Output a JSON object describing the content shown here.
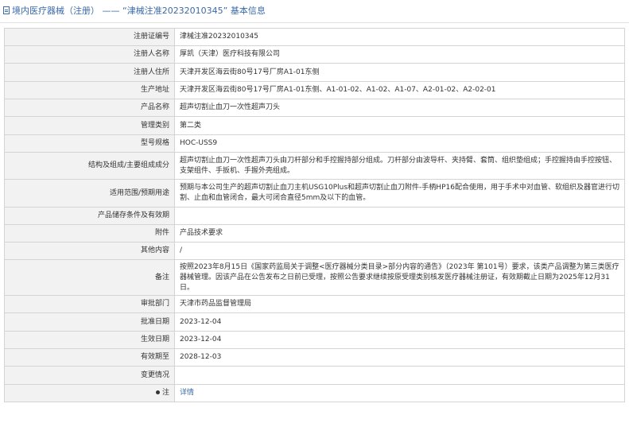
{
  "header": {
    "title": "境内医疗器械（注册） —— “津械注准20232010345” 基本信息"
  },
  "rows": [
    {
      "label": "注册证编号",
      "value": "津械注准20232010345"
    },
    {
      "label": "注册人名称",
      "value": "厚凯（天津）医疗科技有限公司"
    },
    {
      "label": "注册人住所",
      "value": "天津开发区海云街80号17号厂房A1-01东侧"
    },
    {
      "label": "生产地址",
      "value": "天津开发区海云街80号17号厂房A1-01东侧、A1-01-02、A1-02、A1-07、A2-01-02、A2-02-01"
    },
    {
      "label": "产品名称",
      "value": "超声切割止血刀一次性超声刀头"
    },
    {
      "label": "管理类别",
      "value": "第二类"
    },
    {
      "label": "型号规格",
      "value": "HOC-USS9"
    },
    {
      "label": "结构及组成/主要组成成分",
      "value": "超声切割止血刀一次性超声刀头由刀杆部分和手控握持部分组成。刀杆部分由波导杆、夹持臂、套筒、组织垫组成；手控握持由手控按钮、支架组件、手扳机、手握外壳组成。"
    },
    {
      "label": "适用范围/预期用途",
      "value": "预期与本公司生产的超声切割止血刀主机USG10Plus和超声切割止血刀附件-手柄HP16配合使用，用于手术中对血管、软组织及器官进行切割、止血和血管闭合，最大可闭合直径5mm及以下的血管。"
    },
    {
      "label": "产品储存条件及有效期",
      "value": ""
    },
    {
      "label": "附件",
      "value": "产品技术要求"
    },
    {
      "label": "其他内容",
      "value": "/"
    },
    {
      "label": "备注",
      "value": "按照2023年8月15日《国家药监局关于调整<医疗器械分类目录>部分内容的通告》（2023年 第101号）要求，该类产品调整为第三类医疗器械管理。因该产品在公告发布之日前已受理，按照公告要求继续按原受理类别核发医疗器械注册证，有效期截止日期为2025年12月31日。"
    },
    {
      "label": "审批部门",
      "value": "天津市药品监督管理局"
    },
    {
      "label": "批准日期",
      "value": "2023-12-04"
    },
    {
      "label": "生效日期",
      "value": "2023-12-04"
    },
    {
      "label": "有效期至",
      "value": "2028-12-03"
    },
    {
      "label": "变更情况",
      "value": ""
    }
  ],
  "note": {
    "label": "注",
    "link": "详情"
  }
}
